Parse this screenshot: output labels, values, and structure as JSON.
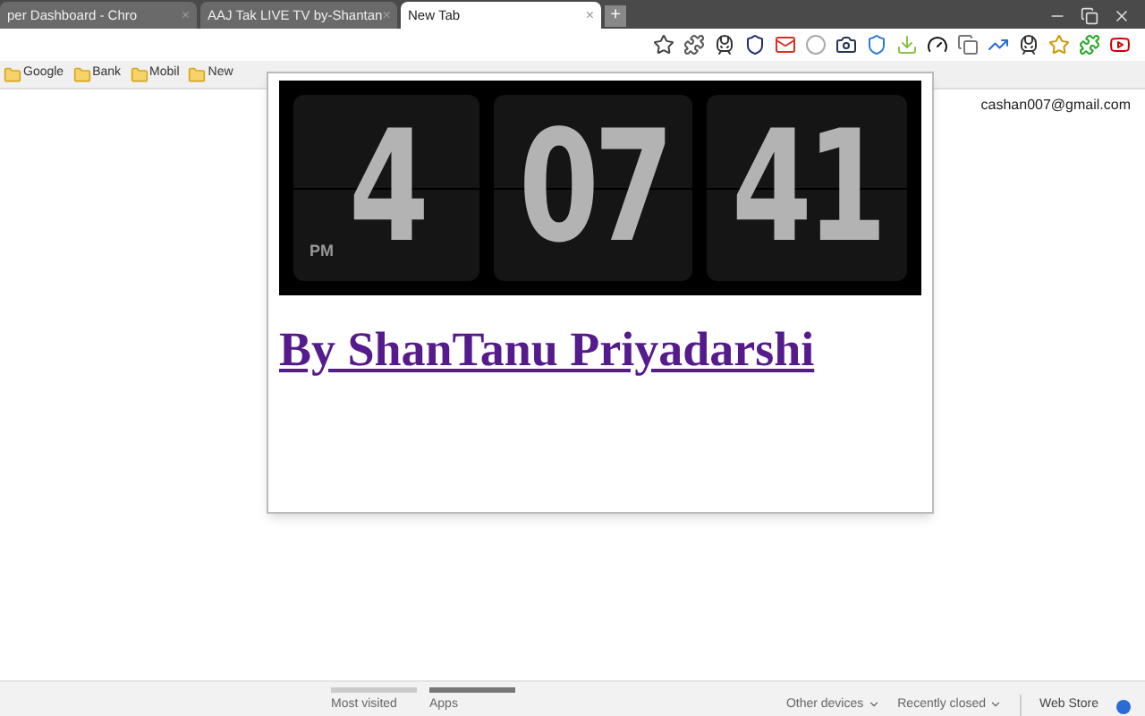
{
  "tabs": [
    {
      "title": "per Dashboard - Chro",
      "close": "×",
      "selected": false
    },
    {
      "title": "AAJ Tak LIVE TV by-Shantan",
      "close": "×",
      "selected": false
    },
    {
      "title": "New Tab",
      "close": "×",
      "selected": true
    }
  ],
  "new_tab_button": "+",
  "bookmarks": [
    {
      "label": "Google"
    },
    {
      "label": "Bank"
    },
    {
      "label": "Mobil"
    },
    {
      "label": "New"
    }
  ],
  "account": "cashan007@gmail.com",
  "popup": {
    "clock": {
      "period": "PM",
      "cards": [
        "4",
        "07",
        "41"
      ]
    },
    "credit": "By ShanTanu Priyadarshi"
  },
  "footer": {
    "sections": [
      {
        "label": "Most visited",
        "selected": false
      },
      {
        "label": "Apps",
        "selected": true
      }
    ],
    "menus": [
      {
        "label": "Other devices"
      },
      {
        "label": "Recently closed"
      }
    ],
    "store": "Web Store"
  }
}
